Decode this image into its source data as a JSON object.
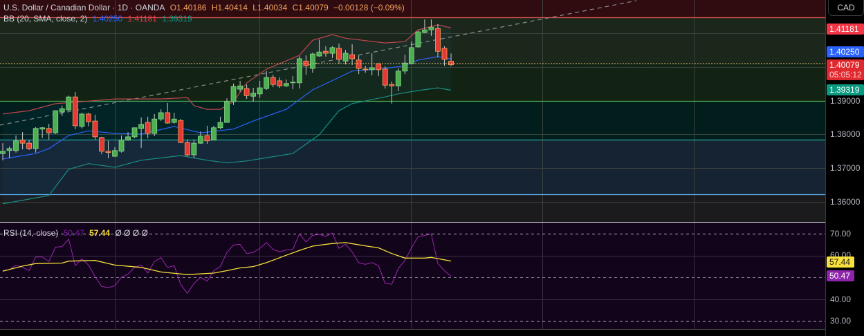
{
  "header": {
    "symbol": "U.S. Dollar / Canadian Dollar · 1D · OANDA",
    "open": "O1.40186",
    "high": "H1.40414",
    "low": "L1.40034",
    "close": "C1.40079",
    "change": "−0.00128 (−0.09%)"
  },
  "bb_legend": {
    "label": "BB (20, SMA, close, 2)",
    "basis": "1.40250",
    "upper": "1.41181",
    "lower": "1.39319"
  },
  "rsi_legend": {
    "label": "RSI (14, close)",
    "rsi": "50.47",
    "ma": "57.44",
    "extras": "Ø Ø Ø Ø"
  },
  "axis": {
    "currency_button": "CAD",
    "price_labels": [
      "1.39000",
      "1.38000",
      "1.37000",
      "1.36000"
    ],
    "tags": {
      "upper": "1.41181",
      "basis": "1.40250",
      "last": "1.40079",
      "countdown": "05:05:12",
      "lower": "1.39319"
    },
    "rsi_labels": [
      "70.00",
      "60.00",
      "40.00",
      "30.00"
    ],
    "rsi_tags": {
      "ma": "57.44",
      "rsi": "50.47"
    }
  },
  "colors": {
    "up": "#4caf50",
    "down": "#e53935",
    "bb_basis": "#2962ff",
    "bb_upper": "#f23645",
    "bb_lower": "#089981",
    "rsi": "#9c27b0",
    "rsi_ma": "#f7e03c"
  },
  "chart_data": [
    {
      "type": "candlestick",
      "title": "U.S. Dollar / Canadian Dollar · 1D · OANDA",
      "ylim": [
        1.352,
        1.4203
      ],
      "yticks": [
        1.36,
        1.37,
        1.38,
        1.39,
        1.41
      ],
      "horizontal_levels": [
        1.415,
        1.39,
        1.3785,
        1.3622
      ],
      "last_price": 1.40079,
      "ohlc": [
        [
          1.3743,
          1.3774,
          1.3723,
          1.375
        ],
        [
          1.3752,
          1.3764,
          1.3729,
          1.3758
        ],
        [
          1.3752,
          1.3797,
          1.3746,
          1.3781
        ],
        [
          1.3783,
          1.3807,
          1.3756,
          1.3774
        ],
        [
          1.3774,
          1.3783,
          1.3754,
          1.3758
        ],
        [
          1.3758,
          1.3822,
          1.3746,
          1.3818
        ],
        [
          1.3816,
          1.3822,
          1.3789,
          1.382
        ],
        [
          1.3818,
          1.3832,
          1.3785,
          1.3805
        ],
        [
          1.3805,
          1.3871,
          1.3801,
          1.3871
        ],
        [
          1.3867,
          1.3886,
          1.3855,
          1.3877
        ],
        [
          1.3873,
          1.3916,
          1.3871,
          1.3912
        ],
        [
          1.3912,
          1.3927,
          1.3816,
          1.3826
        ],
        [
          1.3824,
          1.3865,
          1.3818,
          1.3861
        ],
        [
          1.3861,
          1.3865,
          1.3824,
          1.3838
        ],
        [
          1.384,
          1.3859,
          1.3785,
          1.3793
        ],
        [
          1.3791,
          1.3793,
          1.3741,
          1.375
        ],
        [
          1.375,
          1.3781,
          1.3729,
          1.3746
        ],
        [
          1.3735,
          1.3762,
          1.3733,
          1.3752
        ],
        [
          1.375,
          1.3797,
          1.3746,
          1.3783
        ],
        [
          1.3783,
          1.3807,
          1.3781,
          1.3793
        ],
        [
          1.3793,
          1.382,
          1.3789,
          1.382
        ],
        [
          1.3818,
          1.3851,
          1.376,
          1.383
        ],
        [
          1.3836,
          1.3853,
          1.3789,
          1.3803
        ],
        [
          1.3803,
          1.3861,
          1.3795,
          1.3846
        ],
        [
          1.3846,
          1.3875,
          1.384,
          1.3865
        ],
        [
          1.3865,
          1.3894,
          1.3832,
          1.3834
        ],
        [
          1.3836,
          1.3865,
          1.3832,
          1.3846
        ],
        [
          1.3842,
          1.3846,
          1.3774,
          1.3776
        ],
        [
          1.3776,
          1.3785,
          1.3735,
          1.3739
        ],
        [
          1.3739,
          1.3785,
          1.3729,
          1.3774
        ],
        [
          1.3774,
          1.3809,
          1.3772,
          1.3795
        ],
        [
          1.3797,
          1.3826,
          1.3772,
          1.3781
        ],
        [
          1.3783,
          1.3826,
          1.3783,
          1.382
        ],
        [
          1.382,
          1.3853,
          1.3816,
          1.3836
        ],
        [
          1.3836,
          1.3908,
          1.3836,
          1.3898
        ],
        [
          1.3898,
          1.3952,
          1.3888,
          1.3943
        ],
        [
          1.3935,
          1.396,
          1.3927,
          1.3945
        ],
        [
          1.3937,
          1.3949,
          1.3906,
          1.3916
        ],
        [
          1.3914,
          1.3939,
          1.3898,
          1.3923
        ],
        [
          1.3921,
          1.396,
          1.391,
          1.3939
        ],
        [
          1.3937,
          1.3989,
          1.3933,
          1.397
        ],
        [
          1.397,
          1.3978,
          1.3941,
          1.3949
        ],
        [
          1.396,
          1.397,
          1.3939,
          1.3945
        ],
        [
          1.3945,
          1.3964,
          1.3941,
          1.3952
        ],
        [
          1.3954,
          1.3974,
          1.3935,
          1.3956
        ],
        [
          1.3954,
          1.4034,
          1.3937,
          1.4026
        ],
        [
          1.4019,
          1.4036,
          1.3978,
          1.4005
        ],
        [
          1.3997,
          1.4044,
          1.3984,
          1.404
        ],
        [
          1.4034,
          1.4083,
          1.4032,
          1.4046
        ],
        [
          1.4048,
          1.4063,
          1.4032,
          1.4042
        ],
        [
          1.4042,
          1.4063,
          1.4028,
          1.4059
        ],
        [
          1.4057,
          1.4071,
          1.4011,
          1.4024
        ],
        [
          1.4019,
          1.4052,
          1.4009,
          1.4042
        ],
        [
          1.4038,
          1.4069,
          1.4007,
          1.4026
        ],
        [
          1.4022,
          1.4036,
          1.398,
          1.3997
        ],
        [
          1.3995,
          1.4005,
          1.3984,
          1.3993
        ],
        [
          1.3993,
          1.4042,
          1.3976,
          1.3999
        ],
        [
          1.4011,
          1.4013,
          1.3974,
          1.3993
        ],
        [
          1.3995,
          1.4003,
          1.3937,
          1.3947
        ],
        [
          1.3949,
          1.3958,
          1.3892,
          1.3945
        ],
        [
          1.3945,
          1.3997,
          1.3929,
          1.3989
        ],
        [
          1.3989,
          1.4038,
          1.398,
          1.4013
        ],
        [
          1.4011,
          1.4077,
          1.4009,
          1.4059
        ],
        [
          1.4061,
          1.411,
          1.4059,
          1.4106
        ],
        [
          1.4104,
          1.4143,
          1.4102,
          1.4112
        ],
        [
          1.4112,
          1.4143,
          1.4094,
          1.412
        ],
        [
          1.4116,
          1.4129,
          1.403,
          1.4048
        ],
        [
          1.4057,
          1.4063,
          1.4005,
          1.4024
        ],
        [
          1.40186,
          1.40414,
          1.40034,
          1.40079
        ]
      ],
      "bb_basis": [
        [
          0,
          1.3727
        ],
        [
          5,
          1.3743
        ],
        [
          7,
          1.3758
        ],
        [
          10,
          1.3797
        ],
        [
          13,
          1.3811
        ],
        [
          17,
          1.3803
        ],
        [
          21,
          1.3801
        ],
        [
          26,
          1.3824
        ],
        [
          30,
          1.3805
        ],
        [
          35,
          1.3816
        ],
        [
          38,
          1.384
        ],
        [
          43,
          1.3875
        ],
        [
          47,
          1.3933
        ],
        [
          51,
          1.397
        ],
        [
          53,
          1.3989
        ],
        [
          58,
          1.3997
        ],
        [
          61,
          1.4005
        ],
        [
          63,
          1.4022
        ],
        [
          66,
          1.4032
        ],
        [
          68,
          1.4025
        ]
      ],
      "bb_upper": [
        [
          0,
          1.3861
        ],
        [
          4,
          1.3871
        ],
        [
          8,
          1.3892
        ],
        [
          12,
          1.3898
        ],
        [
          17,
          1.3906
        ],
        [
          24,
          1.3906
        ],
        [
          28,
          1.391
        ],
        [
          29,
          1.3886
        ],
        [
          31,
          1.3875
        ],
        [
          33,
          1.3875
        ],
        [
          35,
          1.3898
        ],
        [
          37,
          1.3954
        ],
        [
          40,
          1.3995
        ],
        [
          45,
          1.4036
        ],
        [
          47,
          1.4081
        ],
        [
          50,
          1.4098
        ],
        [
          52,
          1.4087
        ],
        [
          58,
          1.4073
        ],
        [
          61,
          1.4077
        ],
        [
          63,
          1.4112
        ],
        [
          66,
          1.4127
        ],
        [
          68,
          1.4118
        ]
      ],
      "bb_lower": [
        [
          0,
          1.3593
        ],
        [
          7,
          1.3618
        ],
        [
          10,
          1.3696
        ],
        [
          13,
          1.3713
        ],
        [
          17,
          1.3702
        ],
        [
          21,
          1.3723
        ],
        [
          27,
          1.3737
        ],
        [
          31,
          1.3723
        ],
        [
          34,
          1.3715
        ],
        [
          37,
          1.3721
        ],
        [
          44,
          1.3743
        ],
        [
          48,
          1.3799
        ],
        [
          51,
          1.3871
        ],
        [
          53,
          1.3892
        ],
        [
          58,
          1.3912
        ],
        [
          60,
          1.3921
        ],
        [
          63,
          1.3931
        ],
        [
          66,
          1.3939
        ],
        [
          68,
          1.3932
        ]
      ]
    },
    {
      "type": "line",
      "title": "RSI (14, close)",
      "ylim": [
        26.2,
        75.1
      ],
      "levels": [
        70,
        50,
        30
      ],
      "rsi": [
        53.0,
        53.5,
        55.6,
        54.5,
        53.0,
        59.3,
        59.3,
        57.2,
        63.8,
        64.1,
        67.5,
        55.3,
        58.5,
        55.6,
        50.3,
        45.8,
        45.2,
        46.1,
        50.0,
        51.4,
        54.5,
        55.6,
        51.9,
        57.2,
        59.0,
        54.5,
        55.3,
        46.6,
        42.6,
        47.1,
        50.0,
        48.2,
        53.0,
        54.9,
        61.4,
        64.8,
        65.1,
        60.9,
        61.4,
        63.2,
        65.9,
        62.8,
        61.7,
        62.5,
        62.7,
        69.9,
        66.2,
        69.2,
        69.7,
        68.8,
        70.3,
        63.3,
        65.1,
        61.6,
        56.7,
        55.9,
        56.7,
        55.3,
        47.1,
        46.8,
        54.0,
        57.7,
        63.5,
        68.6,
        69.2,
        69.9,
        56.3,
        53.0,
        50.47
      ],
      "rsi_ma": [
        [
          0,
          52.8
        ],
        [
          3,
          55.1
        ],
        [
          5,
          56.3
        ],
        [
          9,
          56.5
        ],
        [
          10,
          57.4
        ],
        [
          14,
          57.7
        ],
        [
          17,
          55.6
        ],
        [
          21,
          54.5
        ],
        [
          24,
          52.4
        ],
        [
          28,
          51.2
        ],
        [
          32,
          51.9
        ],
        [
          34,
          53.0
        ],
        [
          36,
          54.3
        ],
        [
          38,
          54.9
        ],
        [
          40,
          56.7
        ],
        [
          43,
          60.1
        ],
        [
          45,
          62.3
        ],
        [
          47,
          64.3
        ],
        [
          50,
          65.5
        ],
        [
          52,
          65.9
        ],
        [
          55,
          64.4
        ],
        [
          57,
          63.5
        ],
        [
          59,
          60.9
        ],
        [
          61,
          58.8
        ],
        [
          64,
          58.8
        ],
        [
          65,
          59.1
        ],
        [
          68,
          57.44
        ]
      ]
    }
  ]
}
